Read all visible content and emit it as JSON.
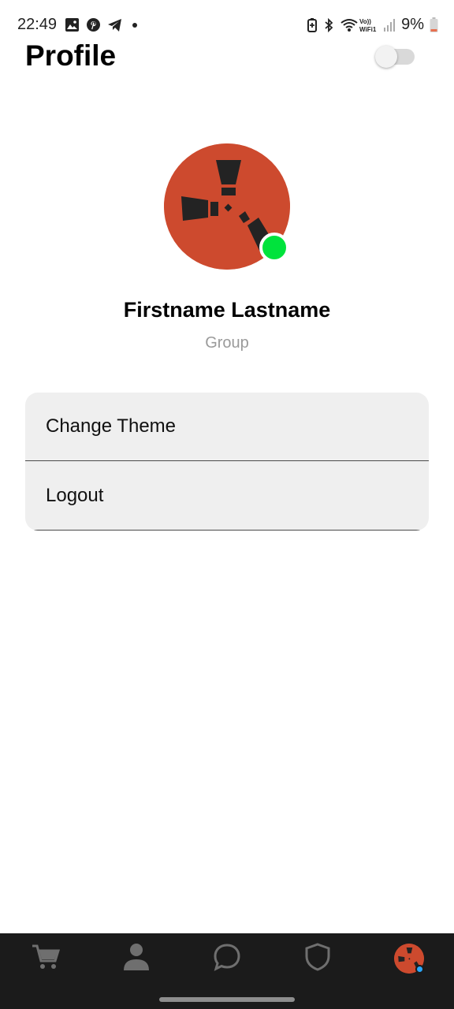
{
  "status_bar": {
    "time": "22:49",
    "battery_percent": "9%",
    "left_icons": [
      "gallery-icon",
      "pinterest-icon",
      "telegram-icon",
      "dot-icon"
    ],
    "right_icons": [
      "battery-saver-icon",
      "bluetooth-icon",
      "wifi-calling-icon",
      "signal-icon",
      "battery-icon"
    ],
    "volte_label_top": "Vo))",
    "volte_label_bottom": "WiFi1"
  },
  "header": {
    "title": "Profile",
    "theme_toggle_on": false
  },
  "profile": {
    "name": "Firstname Lastname",
    "group": "Group",
    "online": true,
    "avatar_color": "#cd4a2e",
    "online_color": "#00e33c"
  },
  "menu": {
    "items": [
      {
        "label": "Change Theme"
      },
      {
        "label": "Logout"
      }
    ]
  },
  "bottom_nav": {
    "items": [
      {
        "icon": "cart-icon"
      },
      {
        "icon": "person-icon"
      },
      {
        "icon": "chat-bubble-icon"
      },
      {
        "icon": "shield-icon"
      },
      {
        "icon": "profile-avatar-icon",
        "active": true
      }
    ]
  },
  "colors": {
    "background": "#ffffff",
    "menu_bg": "#efefef",
    "nav_bg": "#1b1b1b",
    "nav_icon": "#6f6f6f",
    "muted_text": "#9a9a9a"
  }
}
